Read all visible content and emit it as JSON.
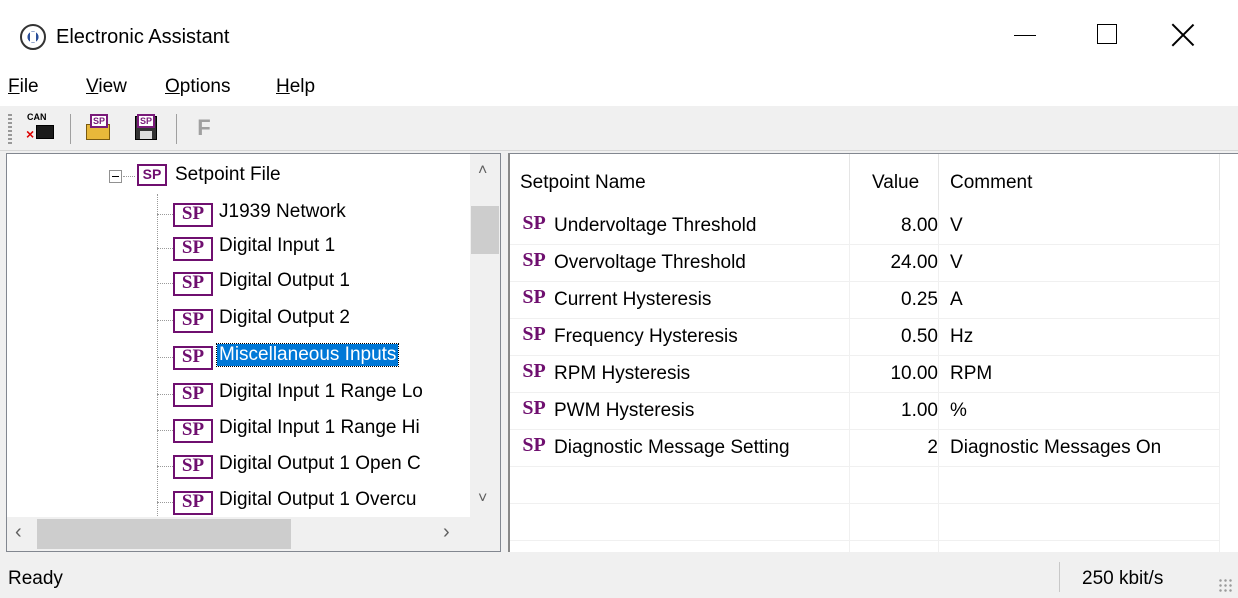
{
  "window": {
    "title": "Electronic Assistant"
  },
  "menu": [
    {
      "label": "File",
      "ul": "F",
      "rest": "ile"
    },
    {
      "label": "View",
      "ul": "V",
      "rest": "iew"
    },
    {
      "label": "Options",
      "ul": "O",
      "rest": "ptions"
    },
    {
      "label": "Help",
      "ul": "H",
      "rest": "elp"
    }
  ],
  "toolbar": {
    "can_label": "CAN",
    "sp_label": "SP",
    "f_label": "F"
  },
  "tree": {
    "root_label": "Setpoint File",
    "root_icon": "SP",
    "items": [
      {
        "label": "J1939 Network",
        "icon": "SP"
      },
      {
        "label": "Digital Input 1",
        "icon": "SP"
      },
      {
        "label": "Digital Output 1",
        "icon": "SP"
      },
      {
        "label": "Digital Output 2",
        "icon": "SP"
      },
      {
        "label": "Miscellaneous Inputs",
        "icon": "SP",
        "selected": true
      },
      {
        "label": "Digital Input 1 Range Lo",
        "icon": "SP"
      },
      {
        "label": "Digital Input 1 Range Hi",
        "icon": "SP"
      },
      {
        "label": "Digital Output 1 Open C",
        "icon": "SP"
      },
      {
        "label": "Digital Output 1 Overcu",
        "icon": "SP"
      }
    ]
  },
  "table": {
    "columns": [
      "Setpoint Name",
      "Value",
      "Comment"
    ],
    "rows": [
      {
        "icon": "SP",
        "name": "Undervoltage Threshold",
        "value": "8.00",
        "comment": "V"
      },
      {
        "icon": "SP",
        "name": "Overvoltage Threshold",
        "value": "24.00",
        "comment": "V"
      },
      {
        "icon": "SP",
        "name": "Current Hysteresis",
        "value": "0.25",
        "comment": "A"
      },
      {
        "icon": "SP",
        "name": "Frequency Hysteresis",
        "value": "0.50",
        "comment": "Hz"
      },
      {
        "icon": "SP",
        "name": "RPM Hysteresis",
        "value": "10.00",
        "comment": "RPM"
      },
      {
        "icon": "SP",
        "name": "PWM Hysteresis",
        "value": "1.00",
        "comment": "%"
      },
      {
        "icon": "SP",
        "name": "Diagnostic Message Setting",
        "value": "2",
        "comment": "Diagnostic Messages On"
      }
    ]
  },
  "status": {
    "text": "Ready",
    "rate": "250 kbit/s"
  },
  "colors": {
    "selection": "#0078d7",
    "sp_icon": "#6f0f6f"
  }
}
